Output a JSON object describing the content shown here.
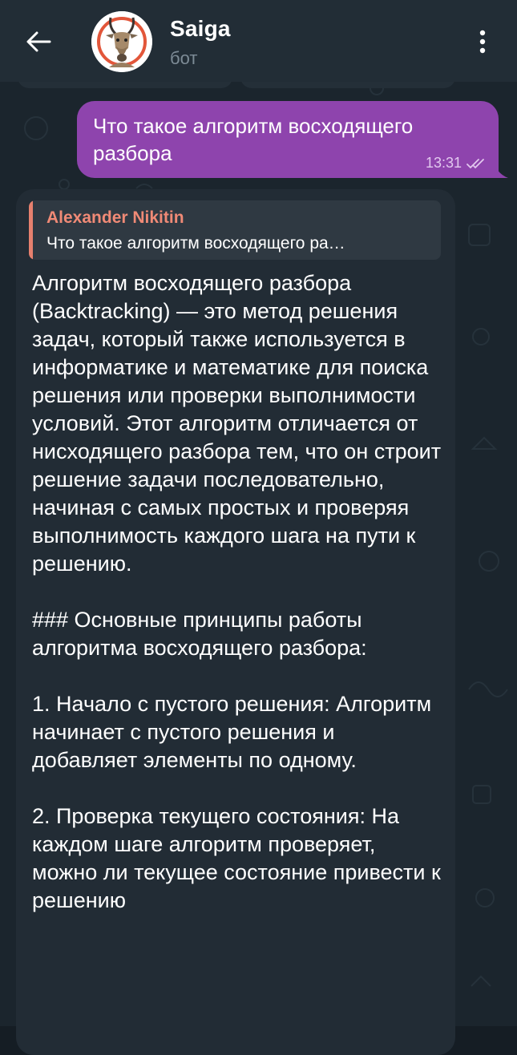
{
  "header": {
    "title": "Saiga",
    "subtitle": "бот"
  },
  "outgoing": {
    "text": "Что такое алгоритм восходящего разбора",
    "time": "13:31"
  },
  "incoming": {
    "reply_to": {
      "name": "Alexander Nikitin",
      "text": "Что такое алгоритм восходящего ра…"
    },
    "paragraphs": [
      "Алгоритм восходящего разбора (Backtracking) — это метод решения задач, который также используется в информатике и математике для поиска решения или проверки выполнимости условий. Этот алгоритм отличается от нисходящего разбора тем, что он строит решение задачи последовательно, начиная с самых простых и проверяя выполнимость каждого шага на пути к решению.",
      "### Основные принципы работы алгоритма восходящего разбора:",
      "1. Начало с пустого решения: Алгоритм начинает с пустого решения и добавляет элементы по одному.",
      "2. Проверка текущего состояния: На каждом шаге алгоритм проверяет, можно ли текущее состояние привести к решению"
    ]
  },
  "colors": {
    "header_bg": "#222d36",
    "chat_bg": "#1b252d",
    "outgoing_bubble": "#8e44ad",
    "incoming_bubble": "#222c35",
    "reply_accent": "#e6806e"
  },
  "icons": {
    "back": "arrow-left-icon",
    "menu": "more-vertical-icon",
    "status": "double-check-icon"
  }
}
